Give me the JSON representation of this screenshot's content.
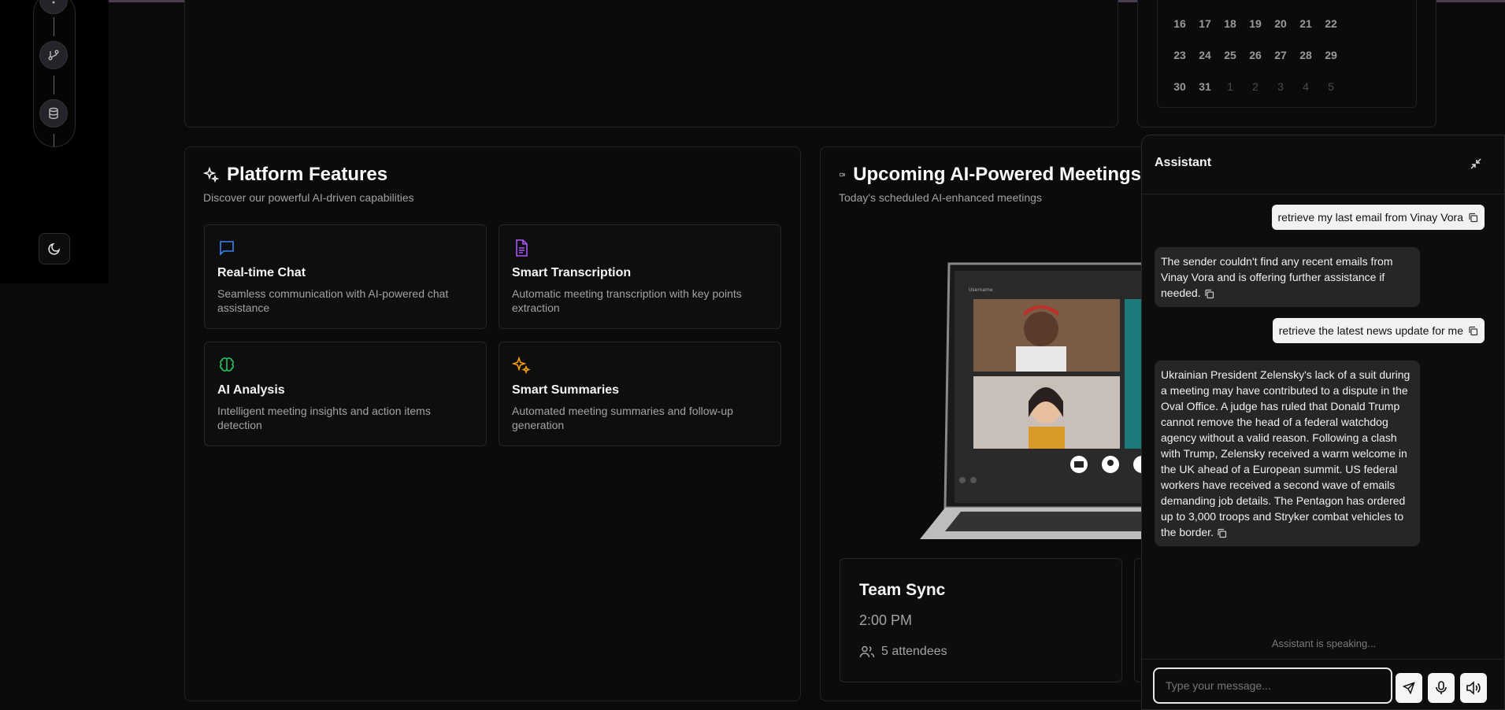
{
  "calendar": {
    "rows": [
      [
        "16",
        "17",
        "18",
        "19",
        "20",
        "21",
        "22"
      ],
      [
        "23",
        "24",
        "25",
        "26",
        "27",
        "28",
        "29"
      ],
      [
        "30",
        "31",
        "1",
        "2",
        "3",
        "4",
        "5"
      ]
    ]
  },
  "features": {
    "title": "Platform Features",
    "subtitle": "Discover our powerful AI-driven capabilities",
    "items": [
      {
        "title": "Real-time Chat",
        "desc": "Seamless communication with AI-powered chat assistance",
        "icon": "chat-icon",
        "color": "#3b82f6"
      },
      {
        "title": "Smart Transcription",
        "desc": "Automatic meeting transcription with key points extraction",
        "icon": "document-icon",
        "color": "#a855f7"
      },
      {
        "title": "AI Analysis",
        "desc": "Intelligent meeting insights and action items detection",
        "icon": "brain-icon",
        "color": "#22c55e"
      },
      {
        "title": "Smart Summaries",
        "desc": "Automated meeting summaries and follow-up generation",
        "icon": "sparkles-icon",
        "color": "#f59e0b"
      }
    ]
  },
  "meetings": {
    "title": "Upcoming AI-Powered Meetings",
    "subtitle": "Today's scheduled AI-enhanced meetings",
    "items": [
      {
        "title": "Team Sync",
        "time": "2:00 PM",
        "attendees": "5 attendees"
      }
    ],
    "laptop_label": "Username"
  },
  "assistant": {
    "title": "Assistant",
    "messages": [
      {
        "role": "user",
        "text": "retrieve my last email from Vinay Vora"
      },
      {
        "role": "bot",
        "text": "The sender couldn't find any recent emails from Vinay Vora and is offering further assistance if needed."
      },
      {
        "role": "user",
        "text": "retrieve the latest news update for me"
      },
      {
        "role": "bot",
        "text": "Ukrainian President Zelensky's lack of a suit during a meeting may have contributed to a dispute in the Oval Office. A judge has ruled that Donald Trump cannot remove the head of a federal watchdog agency without a valid reason. Following a clash with Trump, Zelensky received a warm welcome in the UK ahead of a European summit. US federal workers have received a second wave of emails demanding job details. The Pentagon has ordered up to 3,000 troops and Stryker combat vehicles to the border."
      }
    ],
    "status": "Assistant is speaking...",
    "input_placeholder": "Type your message...",
    "input_value": ""
  }
}
